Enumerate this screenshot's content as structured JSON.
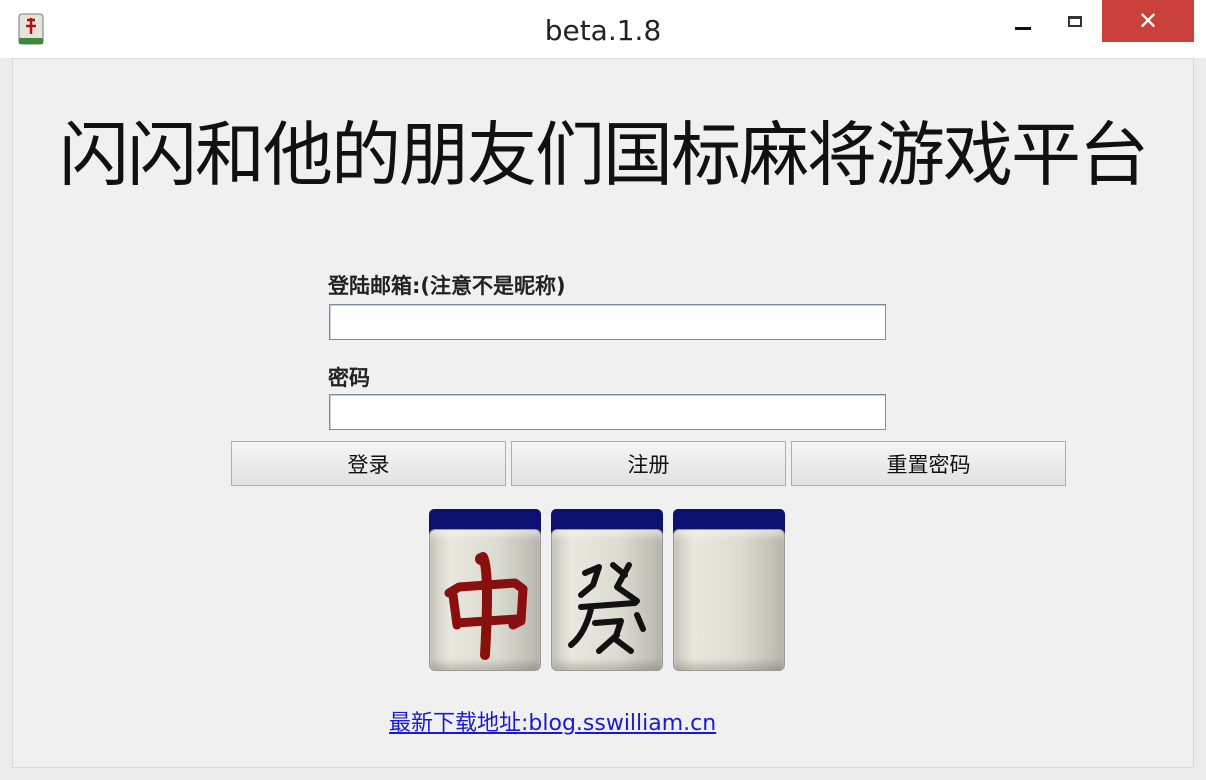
{
  "window": {
    "title": "beta.1.8",
    "close_glyph": "✕"
  },
  "heading": "闪闪和他的朋友们国标麻将游戏平台",
  "form": {
    "email_label": "登陆邮箱:(注意不是昵称)",
    "email_value": "",
    "password_label": "密码",
    "password_value": ""
  },
  "buttons": {
    "login": "登录",
    "register": "注册",
    "reset_password": "重置密码"
  },
  "tiles": [
    "red-dragon-中",
    "green-dragon-發",
    "white-dragon-blank"
  ],
  "download_link": "最新下载地址:blog.sswilliam.cn",
  "colors": {
    "close_button": "#c9413a",
    "tile_back": "#0c1070",
    "link": "#1a1ad0"
  }
}
